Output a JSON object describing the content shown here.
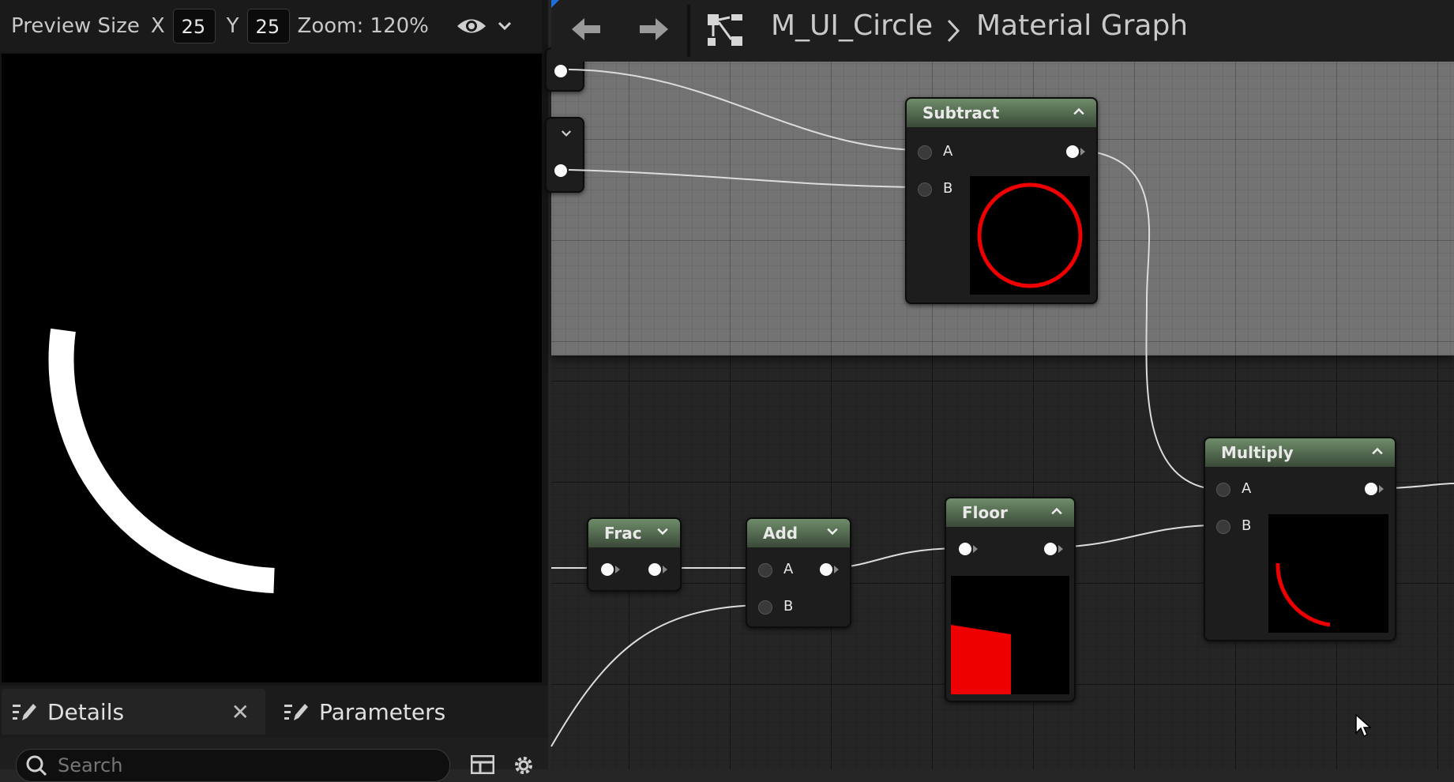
{
  "preview_toolbar": {
    "preview_size_label": "Preview Size",
    "x_label": "X",
    "x_value": "25",
    "y_label": "Y",
    "y_value": "25",
    "zoom_label": "Zoom: 120%",
    "visibility_icon": "eye-icon",
    "options_icon": "chevron-down-icon"
  },
  "preview": {
    "description_colors": {
      "background": "#000000",
      "arc": "#ffffff"
    }
  },
  "bottom_tabs": {
    "details_label": "Details",
    "close_glyph": "✕",
    "parameters_label": "Parameters"
  },
  "search": {
    "placeholder": "Search"
  },
  "graph_header": {
    "asset_name": "M_UI_Circle",
    "graph_name": "Material Graph",
    "back_icon": "arrow-left-icon",
    "forward_icon": "arrow-right-icon",
    "graph_icon": "node-graph-icon",
    "separator_icon": "chevron-right-icon"
  },
  "nodes": {
    "subtract": {
      "title": "Subtract",
      "pin_a": "A",
      "pin_b": "B"
    },
    "multiply": {
      "title": "Multiply",
      "pin_a": "A",
      "pin_b": "B"
    },
    "frac": {
      "title": "Frac"
    },
    "add": {
      "title": "Add",
      "pin_a": "A",
      "pin_b": "B"
    },
    "floor": {
      "title": "Floor"
    }
  },
  "colors": {
    "node_header": "#5a7456",
    "thumbnail_red": "#ee0000",
    "wire": "#d8d8d8",
    "comment_box": "#737373"
  }
}
